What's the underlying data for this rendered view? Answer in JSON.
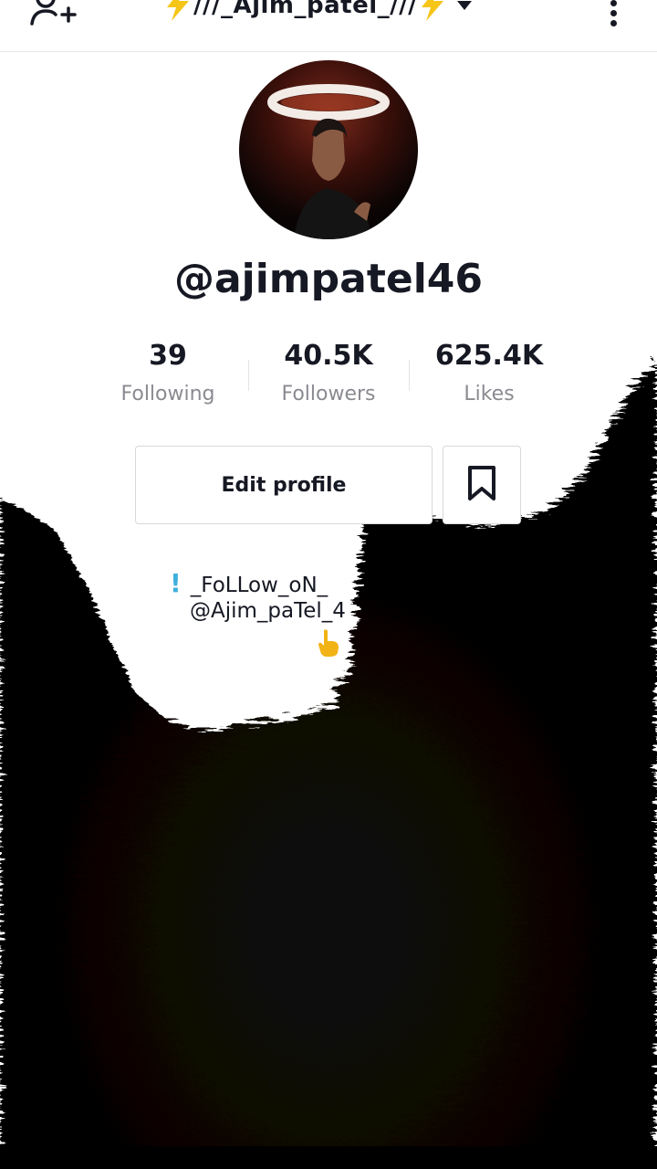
{
  "header": {
    "title": "///_Ajim_patel_///"
  },
  "profile": {
    "username": "@ajimpatel46"
  },
  "stats": {
    "following": {
      "count": "39",
      "label": "Following"
    },
    "followers": {
      "count": "40.5K",
      "label": "Followers"
    },
    "likes": {
      "count": "625.4K",
      "label": "Likes"
    }
  },
  "actions": {
    "edit_profile": "Edit profile"
  },
  "bio": {
    "line1": "_FoLLow_oN_",
    "line2": "@Ajim_paTel_4"
  },
  "colors": {
    "text": "#161823",
    "muted": "#8a8b91",
    "accent_bolt": "#f5c518",
    "bio_marker": "#3fb0dd",
    "pointer": "#f2b316"
  },
  "icons": {
    "add_user": "add-user-icon",
    "bolt": "lightning-bolt-icon",
    "dropdown": "caret-down-icon",
    "menu": "kebab-menu-icon",
    "bookmark": "bookmark-icon",
    "pointer": "pointing-hand-icon"
  }
}
